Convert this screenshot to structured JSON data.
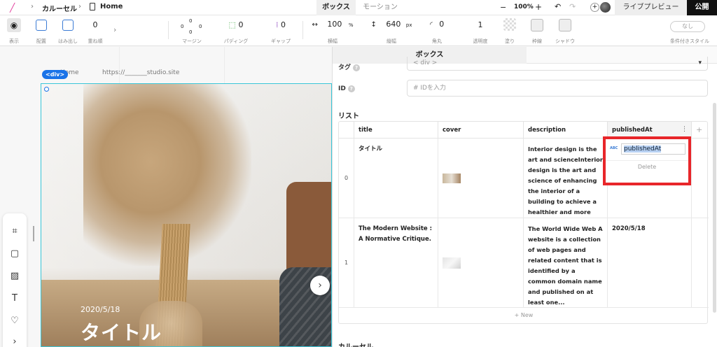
{
  "topbar": {
    "crumb_project": "カルーセル",
    "crumb_page": "Home",
    "tab_box": "ボックス",
    "tab_motion": "モーション",
    "zoom": "100%",
    "zoom_minus": "−",
    "zoom_plus": "+",
    "live_preview": "ライブプレビュー",
    "publish": "公開"
  },
  "toolbar": {
    "display_label": "表示",
    "layout_label": "配置",
    "overflow_label": "はみ出し",
    "zindex_value": "0",
    "zindex_label": "重ね順",
    "margin_label": "マージン",
    "margin_values": [
      "0",
      "0",
      "0",
      "0"
    ],
    "padding_value": "0",
    "padding_label": "パディング",
    "gap_value": "0",
    "gap_label": "ギャップ",
    "width_value": "100",
    "width_unit": "%",
    "width_label": "横幅",
    "height_value": "640",
    "height_unit": "px",
    "height_label": "縦幅",
    "radius_value": "0",
    "radius_label": "角丸",
    "opacity_value": "1",
    "opacity_label": "透明度",
    "fill_label": "塗り",
    "border_label": "枠線",
    "shadow_label": "シャドウ",
    "cond_value": "なし",
    "cond_label": "条件付きスタイル"
  },
  "canvas": {
    "div_badge": "<div>",
    "page_name": "Home",
    "url": "https://_______studio.site",
    "slide_date": "2020/5/18",
    "slide_title": "タイトル",
    "next_arrow": "›"
  },
  "panel": {
    "tab_label": "ボックス",
    "tag_label": "タグ",
    "tag_value": "< div >",
    "id_label": "ID",
    "id_placeholder": "#  IDを入力",
    "list_title": "リスト",
    "columns": [
      "title",
      "cover",
      "description",
      "publishedAt"
    ],
    "rows": [
      {
        "index": "0",
        "title": "タイトル",
        "description": "Interior design is the art and scienceInterior design is the art and science of enhancing the interior of a building to achieve a healthier and more a...",
        "publishedAt": ""
      },
      {
        "index": "1",
        "title": "The Modern Website : A Normative Critique.",
        "description": "The World Wide Web A website is a collection of web pages and related content that is identified by a common domain name and published on at least one...",
        "publishedAt": "2020/5/18"
      }
    ],
    "new_row": "+ New",
    "edit_type_badge": "ABC",
    "edit_value": "publishedAt",
    "edit_delete": "Delete",
    "carousel_title": "カルーセル"
  }
}
